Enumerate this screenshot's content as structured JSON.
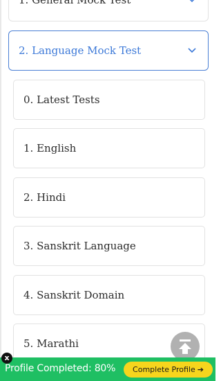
{
  "accordion": {
    "general": {
      "label": "1. General Mock Test",
      "expanded": false
    },
    "language": {
      "label": "2. Language Mock Test",
      "expanded": true
    }
  },
  "language_tests": [
    {
      "label": "0. Latest Tests"
    },
    {
      "label": "1. English"
    },
    {
      "label": "2. Hindi"
    },
    {
      "label": "3. Sanskrit Language"
    },
    {
      "label": "4. Sanskrit Domain"
    },
    {
      "label": "5. Marathi"
    }
  ],
  "scroll_top": {
    "icon": "arrow-up-to-line-icon"
  },
  "profile_banner": {
    "status_text": "Profile Completed: 80%",
    "cta_label": "Complete Profile",
    "cta_arrow": "➔",
    "close_label": "x"
  },
  "colors": {
    "accent_blue": "#3b78d8",
    "banner_green": "#1fbf63",
    "cta_yellow": "#f7d51d"
  }
}
